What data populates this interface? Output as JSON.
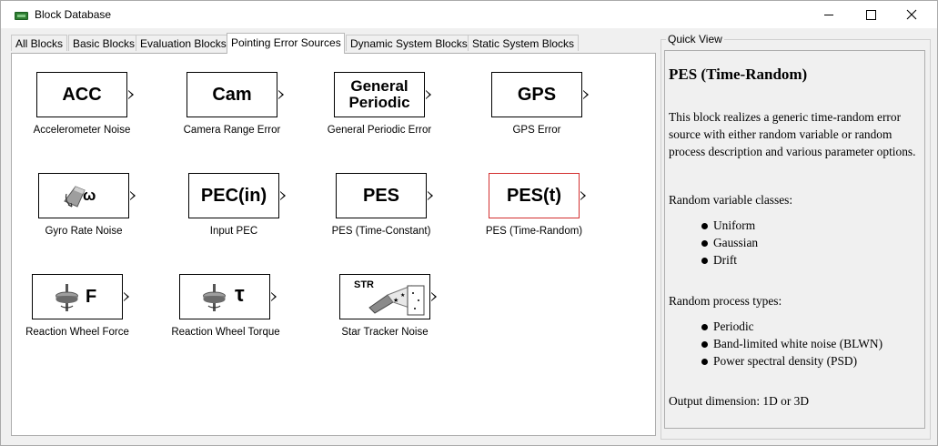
{
  "window": {
    "title": "Block Database",
    "controls": {
      "minimize": "–",
      "maximize": "□",
      "close": "✕"
    }
  },
  "tabs": [
    {
      "label": "All Blocks",
      "active": false
    },
    {
      "label": "Basic Blocks",
      "active": false
    },
    {
      "label": "Evaluation Blocks",
      "active": false
    },
    {
      "label": "Pointing Error Sources",
      "active": true
    },
    {
      "label": "Dynamic System Blocks",
      "active": false
    },
    {
      "label": "Static System Blocks",
      "active": false
    }
  ],
  "blocks": [
    {
      "text": "ACC",
      "label": "Accelerometer Noise"
    },
    {
      "text": "Cam",
      "label": "Camera Range Error"
    },
    {
      "text_line1": "General",
      "text_line2": "Periodic",
      "label": "General Periodic Error"
    },
    {
      "text": "GPS",
      "label": "GPS Error"
    },
    {
      "icon": "gyro-icon",
      "text": "ω",
      "label": "Gyro Rate Noise"
    },
    {
      "text": "PEC(in)",
      "label": "Input PEC"
    },
    {
      "text": "PES",
      "label": "PES (Time-Constant)"
    },
    {
      "text": "PES(t)",
      "label": "PES (Time-Random)",
      "selected": true
    },
    {
      "icon": "reaction-wheel-icon",
      "text": "F",
      "label": "Reaction Wheel Force"
    },
    {
      "icon": "reaction-wheel-icon",
      "text": "τ",
      "label": "Reaction Wheel Torque"
    },
    {
      "icon": "star-tracker-icon",
      "text": "STR",
      "label": "Star Tracker Noise"
    }
  ],
  "quick_view": {
    "legend": "Quick View",
    "title": "PES (Time-Random)",
    "description": "This block realizes a generic time-random error source with either random variable or random process description and various parameter options.",
    "random_variable_heading": "Random variable classes:",
    "random_variable_classes": [
      "Uniform",
      "Gaussian",
      "Drift"
    ],
    "random_process_heading": "Random process types:",
    "random_process_types": [
      "Periodic",
      "Band-limited white noise (BLWN)",
      "Power spectral density (PSD)"
    ],
    "output_dimension": "Output dimension: 1D or 3D"
  },
  "colors": {
    "selected_border": "#d32f2f",
    "panel_bg": "#ffffff",
    "window_bg": "#f0f0f0"
  }
}
